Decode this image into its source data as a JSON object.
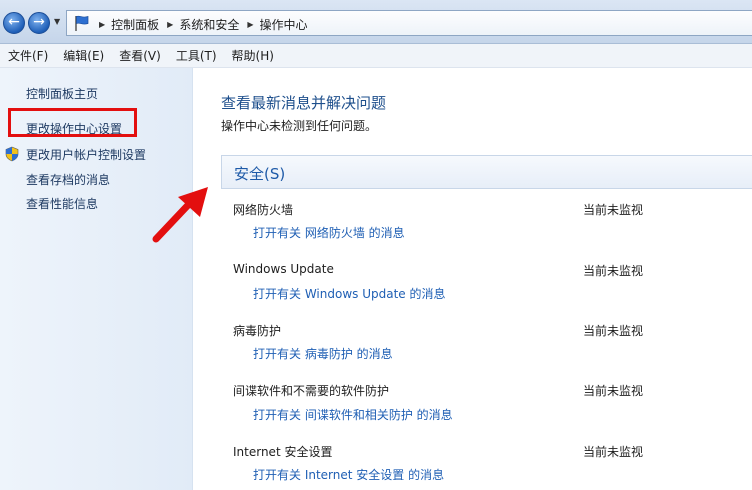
{
  "breadcrumb": [
    "控制面板",
    "系统和安全",
    "操作中心"
  ],
  "menu": [
    "文件(F)",
    "编辑(E)",
    "查看(V)",
    "工具(T)",
    "帮助(H)"
  ],
  "sidebar": {
    "items": [
      {
        "label": "控制面板主页"
      },
      {
        "label": "更改操作中心设置"
      },
      {
        "label": "更改用户帐户控制设置"
      },
      {
        "label": "查看存档的消息"
      },
      {
        "label": "查看性能信息"
      }
    ]
  },
  "main": {
    "title": "查看最新消息并解决问题",
    "subtitle": "操作中心未检测到任何问题。",
    "section_title": "安全(S)",
    "rows": [
      {
        "name": "网络防火墙",
        "link": "打开有关 网络防火墙 的消息",
        "status": "当前未监视"
      },
      {
        "name": "Windows Update",
        "link": "打开有关 Windows Update 的消息",
        "status": "当前未监视"
      },
      {
        "name": "病毒防护",
        "link": "打开有关 病毒防护 的消息",
        "status": "当前未监视"
      },
      {
        "name": "间谍软件和不需要的软件防护",
        "link": "打开有关 间谍软件和相关防护 的消息",
        "status": "当前未监视"
      },
      {
        "name": "Internet 安全设置",
        "link": "打开有关 Internet 安全设置 的消息",
        "status": "当前未监视"
      }
    ]
  },
  "colors": {
    "highlight": "#e30f0f",
    "link": "#1f5fb4",
    "title": "#1e4f8c"
  },
  "icons": [
    "back-arrow-icon",
    "forward-arrow-icon",
    "flag-icon",
    "uac-shield-icon",
    "annotation-arrow-icon"
  ]
}
